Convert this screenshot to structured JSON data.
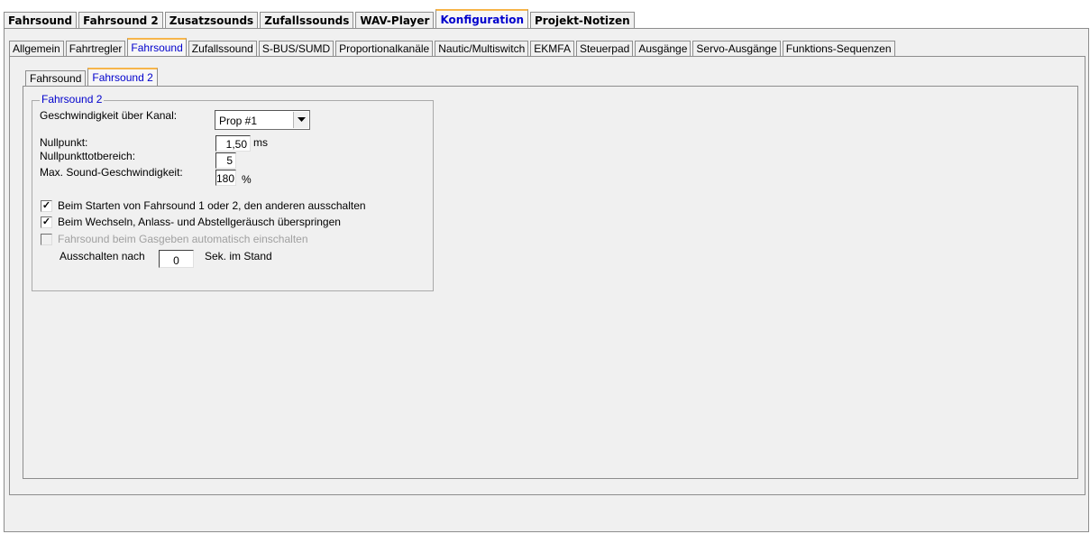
{
  "main_tabs": [
    "Fahrsound",
    "Fahrsound 2",
    "Zusatzsounds",
    "Zufallssounds",
    "WAV-Player",
    "Konfiguration",
    "Projekt-Notizen"
  ],
  "config_tabs": [
    "Allgemein",
    "Fahrtregler",
    "Fahrsound",
    "Zufallssound",
    "S-BUS/SUMD",
    "Proportionalkanäle",
    "Nautic/Multiswitch",
    "EKMFA",
    "Steuerpad",
    "Ausgänge",
    "Servo-Ausgänge",
    "Funktions-Sequenzen"
  ],
  "sub_tabs": [
    "Fahrsound",
    "Fahrsound 2"
  ],
  "group": {
    "title": "Fahrsound 2",
    "speed_channel_label": "Geschwindigkeit über Kanal:",
    "speed_channel_value": "Prop #1",
    "nullpunkt_label": "Nullpunkt:",
    "nullpunkt_value": "1,50",
    "nullpunkt_unit": "ms",
    "deadband_label": "Nullpunkttotbereich:",
    "deadband_value": "5",
    "maxspeed_label": "Max. Sound-Geschwindigkeit:",
    "maxspeed_value": "180",
    "maxspeed_unit": "%",
    "check1_label": "Beim Starten von Fahrsound 1 oder 2, den anderen ausschalten",
    "check1_checked": true,
    "check2_label": "Beim Wechseln, Anlass- und Abstellgeräusch überspringen",
    "check2_checked": true,
    "check3_label": "Fahrsound beim Gasgeben automatisch einschalten",
    "check3_checked": false,
    "auto_off_label": "Ausschalten nach",
    "auto_off_value": "0",
    "auto_off_suffix": "Sek. im Stand"
  },
  "colors": {
    "active_tab_text": "#0000cc",
    "active_tab_accent": "#f7b54a",
    "panel_bg": "#f0f0f0"
  },
  "icons": {
    "dropdown": "chevron-down-icon",
    "checkmark": "check-icon"
  }
}
